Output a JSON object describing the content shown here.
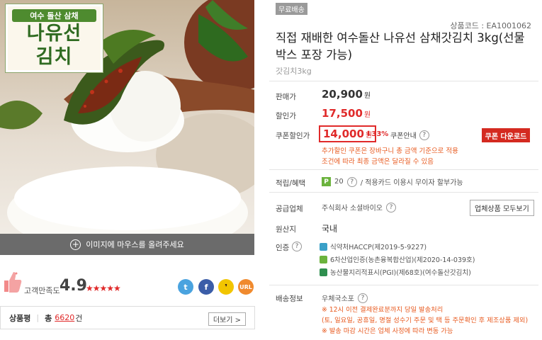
{
  "image": {
    "label_top": "여수 돌산 삼채",
    "label_line1": "나유선",
    "label_line2": "김치",
    "mouse_hint": "이미지에 마우스를 올려주세요"
  },
  "rating": {
    "label": "고객만족도",
    "score": "4.9",
    "stars": "★★★★★",
    "share": {
      "twitter": "t",
      "facebook": "f",
      "kakao": "❜",
      "url": "URL"
    }
  },
  "review": {
    "label": "상품평",
    "total_label": "총",
    "count": "6620",
    "unit": "건",
    "more": "더보기 >"
  },
  "product": {
    "badge": "무료배송",
    "code": "상품코드 : EA1001062",
    "title": "직접 재배한 여수돌산 나유선 삼채갓김치 3kg(선물박스 포장 가능)",
    "subtitle": "갓김치3kg"
  },
  "price": {
    "orig_label": "판매가",
    "orig_value": "20,900",
    "sale_label": "할인가",
    "sale_value": "17,500",
    "won": "원",
    "coupon_label": "쿠폰할인가",
    "coupon_value": "14,000",
    "coupon_pct": "⬇33%",
    "coupon_info": "쿠폰안내",
    "coupon_button": "쿠폰 다운로드",
    "coupon_note1": "추가할인 쿠폰은 장바구니 총 금액 기준으로 적용",
    "coupon_note2": "조건에 따라 최종 금액은 달라질 수 있음"
  },
  "benefits": {
    "label": "적립/혜택",
    "points": "20",
    "card_text": "/ 적용카드 이용시 무이자 할부가능"
  },
  "supplier": {
    "label": "공급업체",
    "name": "주식회사 소셜바이오",
    "button": "업체상품 모두보기"
  },
  "origin": {
    "label": "원산지",
    "value": "국내"
  },
  "certification": {
    "label": "인증",
    "items": [
      {
        "text": "식약처HACCP(제2019-5-9227)",
        "color": "#3aa0c8"
      },
      {
        "text": "6차산업인증(농촌융복합산업)(제2020-14-039호)",
        "color": "#6bb33d"
      },
      {
        "text": "농산물지리적표시(PGI)(제68호)(여수돌산갓김치)",
        "color": "#2f8f4f"
      }
    ]
  },
  "shipping": {
    "label": "배송정보",
    "method": "우체국소포",
    "note1": "※ 12시 이전 결제완료분까지 당일 발송처리",
    "note2": "(토, 일요일, 공휴일, 명절 성수기 주문 및 택 등 주문확인 후 제조상품 제외)",
    "note3": "※ 발송 마감 시간은 업체 사정에 따라 변동 가능"
  },
  "colors": {
    "accent_red": "#e02a2a",
    "note_orange": "#e85a1f",
    "coupon_button": "#d42a20"
  }
}
